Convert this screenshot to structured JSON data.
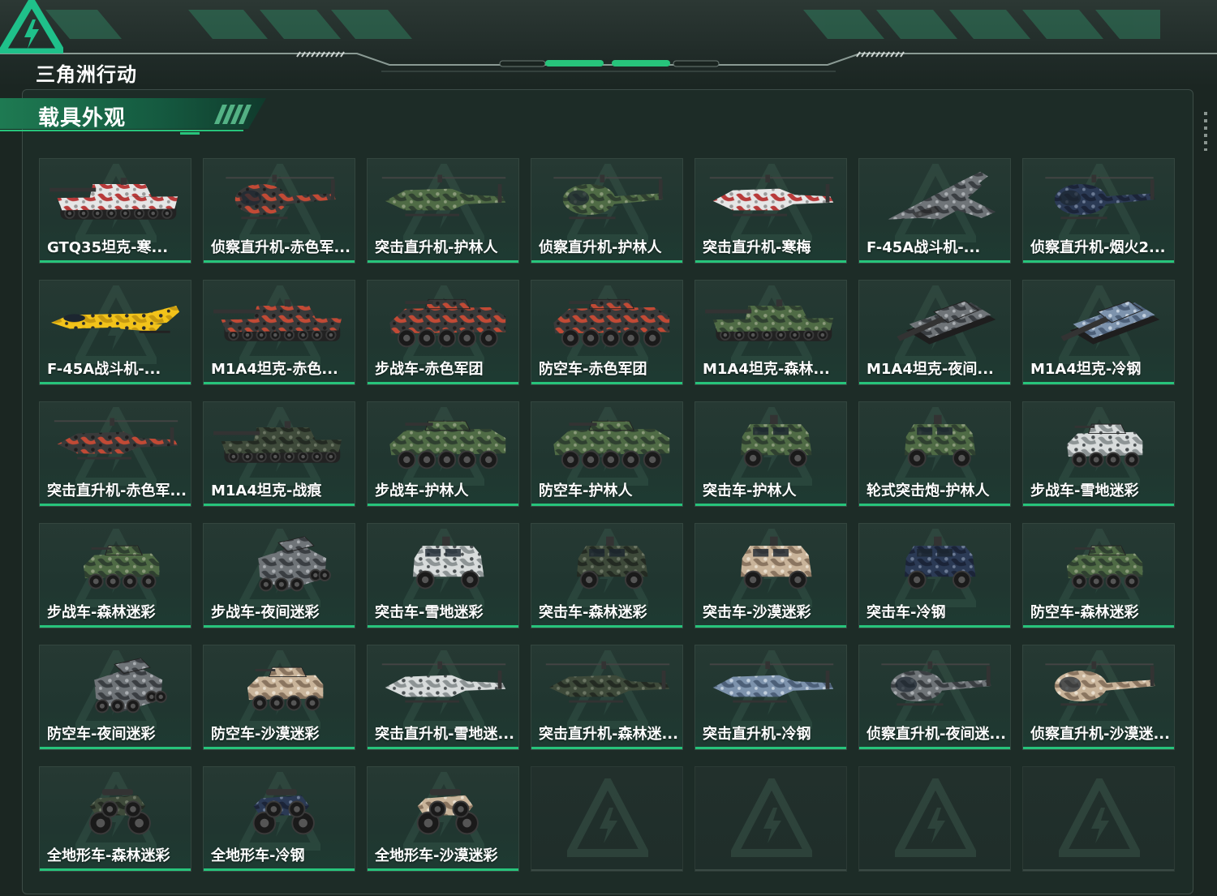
{
  "header": {
    "logo_text": "三角洲行动",
    "colors": {
      "accent": "#27c47b",
      "logo_green": "#1fc08a"
    }
  },
  "panel": {
    "title": "载具外观"
  },
  "vehicles": [
    {
      "label": "GTQ35坦克-寒...",
      "kind": "tank",
      "camo": "snow-red"
    },
    {
      "label": "侦察直升机-赤色军...",
      "kind": "scout-heli",
      "camo": "red"
    },
    {
      "label": "突击直升机-护林人",
      "kind": "attack-heli",
      "camo": "forest"
    },
    {
      "label": "侦察直升机-护林人",
      "kind": "scout-heli",
      "camo": "forest"
    },
    {
      "label": "突击直升机-寒梅",
      "kind": "attack-heli",
      "camo": "snow-red"
    },
    {
      "label": "F-45A战斗机-...",
      "kind": "jet-top",
      "camo": "grey"
    },
    {
      "label": "侦察直升机-烟火2...",
      "kind": "scout-heli",
      "camo": "navy"
    },
    {
      "label": "F-45A战斗机-...",
      "kind": "jet-side",
      "camo": "yellow"
    },
    {
      "label": "M1A4坦克-赤色...",
      "kind": "tank",
      "camo": "red"
    },
    {
      "label": "步战车-赤色军团",
      "kind": "ifv",
      "camo": "red"
    },
    {
      "label": "防空车-赤色军团",
      "kind": "ifv",
      "camo": "red"
    },
    {
      "label": "M1A4坦克-森林...",
      "kind": "tank",
      "camo": "forest"
    },
    {
      "label": "M1A4坦克-夜间...",
      "kind": "tank-angle",
      "camo": "grey"
    },
    {
      "label": "M1A4坦克-冷钢",
      "kind": "tank-angle",
      "camo": "steel"
    },
    {
      "label": "突击直升机-赤色军...",
      "kind": "attack-heli",
      "camo": "red"
    },
    {
      "label": "M1A4坦克-战痕",
      "kind": "tank",
      "camo": "dark"
    },
    {
      "label": "步战车-护林人",
      "kind": "ifv",
      "camo": "forest"
    },
    {
      "label": "防空车-护林人",
      "kind": "ifv",
      "camo": "forest"
    },
    {
      "label": "突击车-护林人",
      "kind": "mrap",
      "camo": "forest"
    },
    {
      "label": "轮式突击炮-护林人",
      "kind": "mrap",
      "camo": "forest"
    },
    {
      "label": "步战车-雪地迷彩",
      "kind": "ifv-small",
      "camo": "snow"
    },
    {
      "label": "步战车-森林迷彩",
      "kind": "ifv-small",
      "camo": "forest"
    },
    {
      "label": "步战车-夜间迷彩",
      "kind": "ifv-angle",
      "camo": "grey"
    },
    {
      "label": "突击车-雪地迷彩",
      "kind": "mrap",
      "camo": "snow"
    },
    {
      "label": "突击车-森林迷彩",
      "kind": "mrap",
      "camo": "dark"
    },
    {
      "label": "突击车-沙漠迷彩",
      "kind": "mrap",
      "camo": "desert"
    },
    {
      "label": "突击车-冷钢",
      "kind": "mrap",
      "camo": "navy"
    },
    {
      "label": "防空车-森林迷彩",
      "kind": "ifv-small",
      "camo": "forest"
    },
    {
      "label": "防空车-夜间迷彩",
      "kind": "ifv-angle",
      "camo": "grey"
    },
    {
      "label": "防空车-沙漠迷彩",
      "kind": "ifv-small",
      "camo": "desert"
    },
    {
      "label": "突击直升机-雪地迷...",
      "kind": "attack-heli",
      "camo": "snow"
    },
    {
      "label": "突击直升机-森林迷...",
      "kind": "attack-heli",
      "camo": "dark"
    },
    {
      "label": "突击直升机-冷钢",
      "kind": "attack-heli",
      "camo": "steel"
    },
    {
      "label": "侦察直升机-夜间迷...",
      "kind": "scout-heli",
      "camo": "grey"
    },
    {
      "label": "侦察直升机-沙漠迷...",
      "kind": "scout-heli",
      "camo": "desert"
    },
    {
      "label": "全地形车-森林迷彩",
      "kind": "atv",
      "camo": "dark"
    },
    {
      "label": "全地形车-冷钢",
      "kind": "atv",
      "camo": "navy"
    },
    {
      "label": "全地形车-沙漠迷彩",
      "kind": "atv",
      "camo": "desert"
    }
  ],
  "empty_slots": 4,
  "camo_colors": {
    "snow-red": [
      "#e6e6e6",
      "#b83a3a",
      "#9a9a9a"
    ],
    "red": [
      "#3a3a3a",
      "#c24a35",
      "#1e1e1e"
    ],
    "forest": [
      "#4f6b45",
      "#2f4030",
      "#8a9a7a"
    ],
    "grey": [
      "#6f7478",
      "#3a3e42",
      "#a9adb1"
    ],
    "navy": [
      "#2b3a55",
      "#1b2438",
      "#6b7a94"
    ],
    "yellow": [
      "#f2c31a",
      "#c79a10",
      "#2a2a2a"
    ],
    "steel": [
      "#7d93ad",
      "#4c5f78",
      "#c2cfdd"
    ],
    "dark": [
      "#3e4a3a",
      "#232a22",
      "#6b7563"
    ],
    "snow": [
      "#d8dcdc",
      "#8d9495",
      "#4a5052"
    ],
    "desert": [
      "#c9b49a",
      "#8a7560",
      "#e8ddcc"
    ]
  }
}
